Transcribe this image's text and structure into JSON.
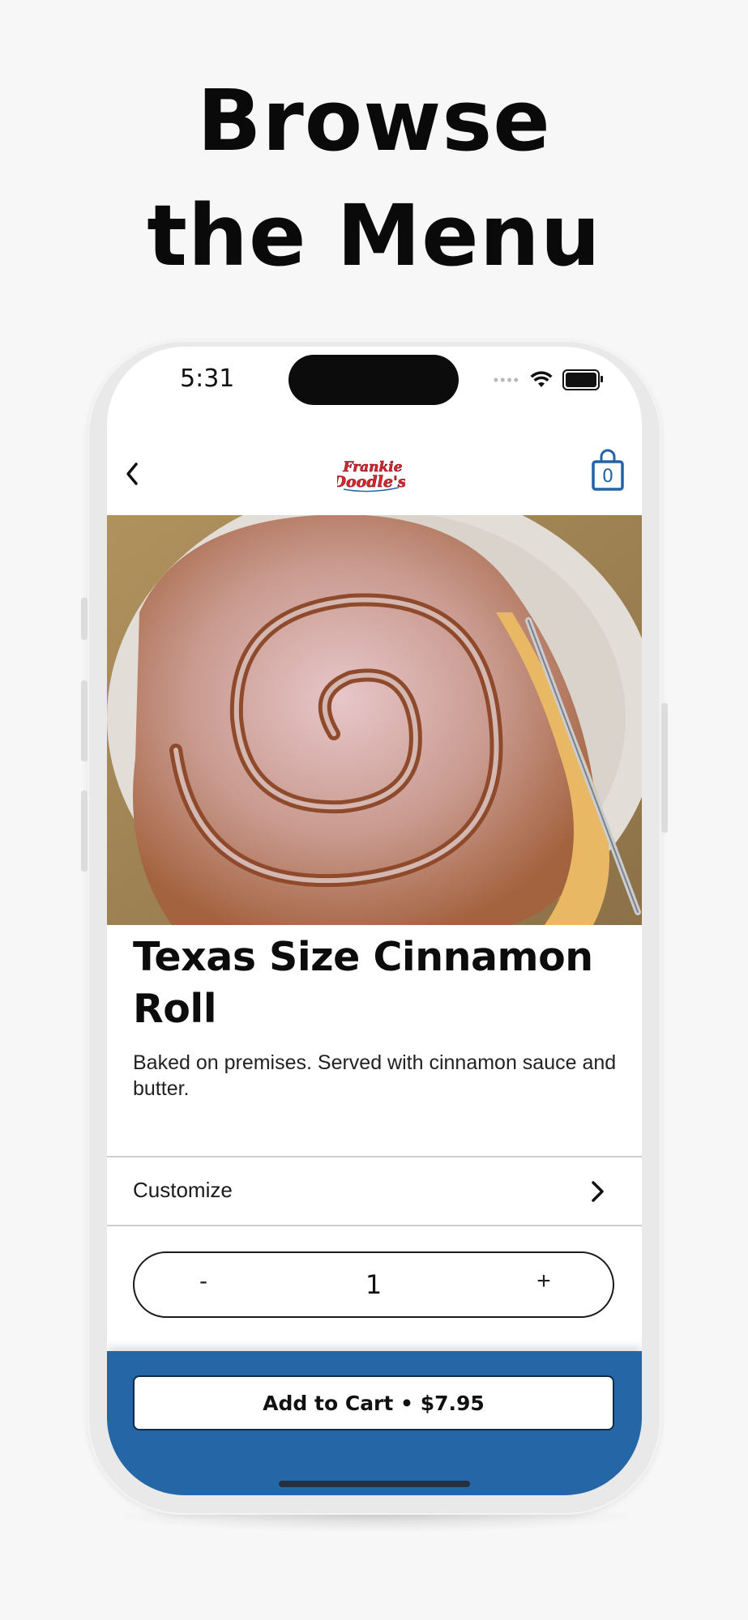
{
  "headline": {
    "line1": "Browse",
    "line2": "the Menu"
  },
  "status_bar": {
    "time": "5:31"
  },
  "nav": {
    "logo_text": "Frankie Doodle's",
    "cart_count": "0"
  },
  "item": {
    "title": "Texas Size Cinnamon Roll",
    "description": "Baked on premises. Served with cinnamon sauce and butter."
  },
  "customize": {
    "label": "Customize"
  },
  "quantity": {
    "minus": "-",
    "value": "1",
    "plus": "+"
  },
  "footer": {
    "add_to_cart_label": "Add to Cart • $7.95"
  },
  "colors": {
    "brand_blue": "#2466a6",
    "logo_red": "#d8262f"
  },
  "icons": [
    "back-chevron-icon",
    "shopping-bag-icon",
    "chevron-right-icon",
    "wifi-icon",
    "battery-icon"
  ]
}
